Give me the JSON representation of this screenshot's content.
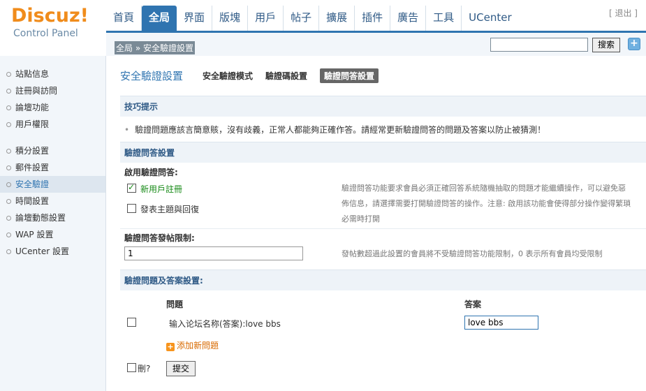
{
  "logo": {
    "brand": "Discuz!",
    "subtitle": "Control Panel"
  },
  "nav": {
    "items": [
      "首頁",
      "全局",
      "界面",
      "版塊",
      "用戶",
      "帖子",
      "擴展",
      "插件",
      "廣告",
      "工具",
      "UCenter"
    ],
    "active": "全局",
    "logout": "[ 退出 ]"
  },
  "subbar": {
    "breadcrumb": "全局 » 安全驗證設置",
    "search_value": "",
    "search_button": "搜索",
    "plus_button": "+"
  },
  "sidebar": {
    "groups": [
      [
        "站點信息",
        "註冊與訪問",
        "論壇功能",
        "用戶權限"
      ],
      [
        "積分設置",
        "郵件設置",
        "安全驗證",
        "時間設置",
        "論壇動態設置",
        "WAP 設置",
        "UCenter 設置"
      ]
    ],
    "active": "安全驗證"
  },
  "page": {
    "title": "安全驗證設置",
    "tabs": [
      {
        "label": "安全驗證模式",
        "active": false
      },
      {
        "label": "驗證碼設置",
        "active": false
      },
      {
        "label": "驗證問答設置",
        "active": true
      }
    ]
  },
  "tips": {
    "heading": "技巧提示",
    "line": "驗證問題應該言簡意賅，沒有歧義，正常人都能夠正確作答。請經常更新驗證問答的問題及答案以防止被猜測！"
  },
  "qa_settings": {
    "heading": "驗證問答設置",
    "enable_label": "啟用驗證問答:",
    "options": [
      {
        "label": "新用戶註冊",
        "checked": true
      },
      {
        "label": "發表主題與回復",
        "checked": false
      }
    ],
    "enable_desc_lines": [
      "驗證問答功能要求會員必須正確回答系統隨機抽取的問題才能繼續操作，可以避免惡",
      "佈信息，請選擇需要打開驗證問答的操作。注意: 啟用該功能會使得部分操作變得繁瑣",
      "必需時打開"
    ],
    "post_limit_label": "驗證問答發帖限制:",
    "post_limit_value": "1",
    "post_limit_desc": "發帖數超過此設置的會員將不受驗證問答功能限制，0 表示所有會員均受限制"
  },
  "qa_list": {
    "heading": "驗證問題及答案設置:",
    "col_question": "問題",
    "col_answer": "答案",
    "rows": [
      {
        "question": "输入论坛名称(答案):love bbs",
        "answer": "love bbs"
      }
    ],
    "add_label": "添加新問題",
    "delete_label": "刪?",
    "submit_label": "提交"
  }
}
